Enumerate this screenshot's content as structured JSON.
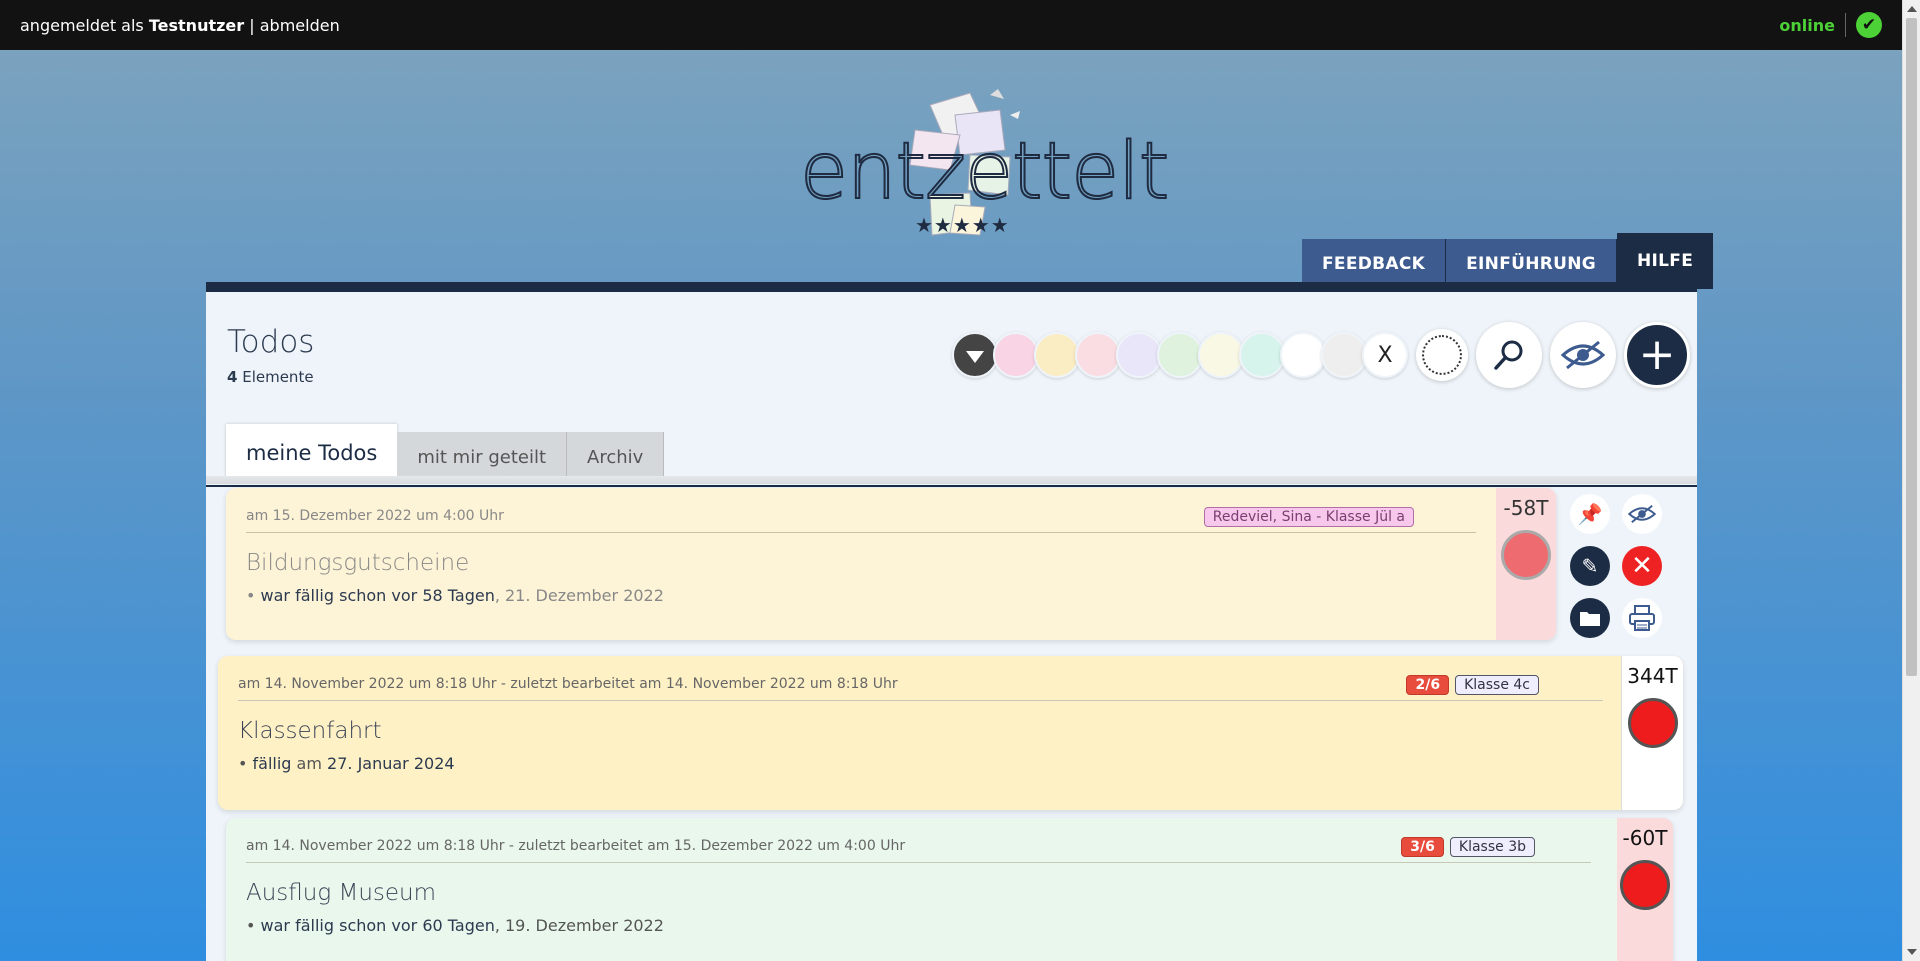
{
  "topbar": {
    "prefix": "angemeldet als",
    "username": "Testnutzer",
    "separator": "|",
    "logout": "abmelden",
    "status": "online"
  },
  "logo": {
    "word": "entzettelt",
    "stars": "★★★★★"
  },
  "nav": {
    "tabs": [
      {
        "label": "FEEDBACK"
      },
      {
        "label": "EINFÜHRUNG"
      },
      {
        "label": "HILFE",
        "active": true
      }
    ]
  },
  "main": {
    "title": "Todos",
    "count": "4",
    "count_label": "Elemente",
    "tabs": [
      {
        "label": "meine Todos",
        "active": true
      },
      {
        "label": "mit mir geteilt"
      },
      {
        "label": "Archiv"
      }
    ],
    "color_filters": [
      "#f9d4e5",
      "#fbedc3",
      "#f9dde3",
      "#e8e6f8",
      "#def2de",
      "#f8f8e4",
      "#d6f3ec",
      "#ffffff",
      "#eeeeee"
    ],
    "clear_label": "X"
  },
  "todos": [
    {
      "meta": "am 15. Dezember 2022 um 4:00 Uhr",
      "badges": [
        "Redeviel, Sina - Klasse Jül a"
      ],
      "title": "Bildungsgutscheine",
      "due_prefix": "•",
      "due_bold": "war fällig schon vor 58 Tagen",
      "due_rest": ", 21. Dezember 2022",
      "days": "-58T"
    },
    {
      "meta": "am 14. November 2022 um 8:18 Uhr - zuletzt bearbeitet am 14. November 2022 um 8:18 Uhr",
      "progress": "2/6",
      "badges": [
        "Klasse 4c"
      ],
      "title": "Klassenfahrt",
      "due_prefix": "•",
      "due_bold": "fällig",
      "due_rest": " am ",
      "due_date": "27. Januar 2024",
      "days": "344T"
    },
    {
      "meta": "am 14. November 2022 um 8:18 Uhr - zuletzt bearbeitet am 15. Dezember 2022 um 4:00 Uhr",
      "progress": "3/6",
      "badges": [
        "Klasse 3b"
      ],
      "title": "Ausflug Museum",
      "due_prefix": "•",
      "due_bold": "war fällig schon vor 60 Tagen",
      "due_rest": ", 19. Dezember 2022",
      "days": "-60T"
    }
  ]
}
